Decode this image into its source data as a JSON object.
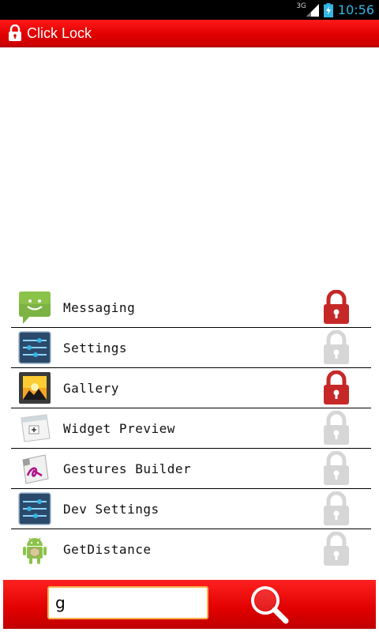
{
  "status_bar": {
    "network": "3G",
    "time": "10:56"
  },
  "app_bar": {
    "title": "Click Lock",
    "icon": "lock-icon"
  },
  "apps": [
    {
      "name": "Messaging",
      "icon": "messaging-icon",
      "locked": true
    },
    {
      "name": "Settings",
      "icon": "settings-icon",
      "locked": false
    },
    {
      "name": "Gallery",
      "icon": "gallery-icon",
      "locked": true
    },
    {
      "name": "Widget Preview",
      "icon": "widget-preview-icon",
      "locked": false
    },
    {
      "name": "Gestures Builder",
      "icon": "gestures-builder-icon",
      "locked": false
    },
    {
      "name": "Dev Settings",
      "icon": "dev-settings-icon",
      "locked": false
    },
    {
      "name": "GetDistance",
      "icon": "android-icon",
      "locked": false
    }
  ],
  "search": {
    "value": "g",
    "icon": "search-icon"
  },
  "colors": {
    "accent_red": "#e00000",
    "locked_color": "#c62828",
    "unlocked_color": "#d6d6d6",
    "status_blue": "#33b5e5"
  }
}
